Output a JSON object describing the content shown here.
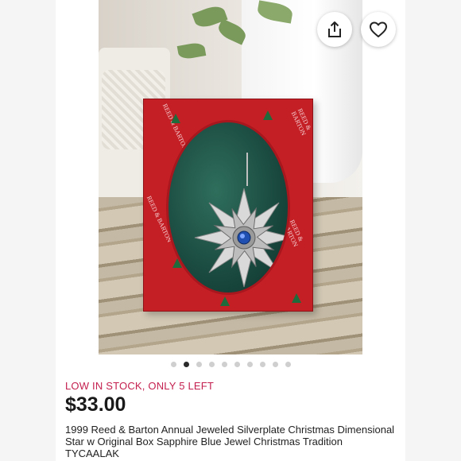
{
  "photo": {
    "carousel": {
      "count": 10,
      "active_index": 1
    },
    "box_print": "REED & BARTON"
  },
  "actions": {
    "share_icon": "share-icon",
    "like_icon": "heart-icon"
  },
  "listing": {
    "stock_status": "LOW IN STOCK, ONLY 5 LEFT",
    "price": "$33.00",
    "title": "1999 Reed & Barton Annual Jeweled Silverplate Christmas Dimensional Star w Original Box Sapphire Blue Jewel Christmas Tradition TYCAALAK"
  },
  "colors": {
    "stock": "#c4204f",
    "box_red": "#c51f26",
    "jewel": "#1f4fb0"
  }
}
